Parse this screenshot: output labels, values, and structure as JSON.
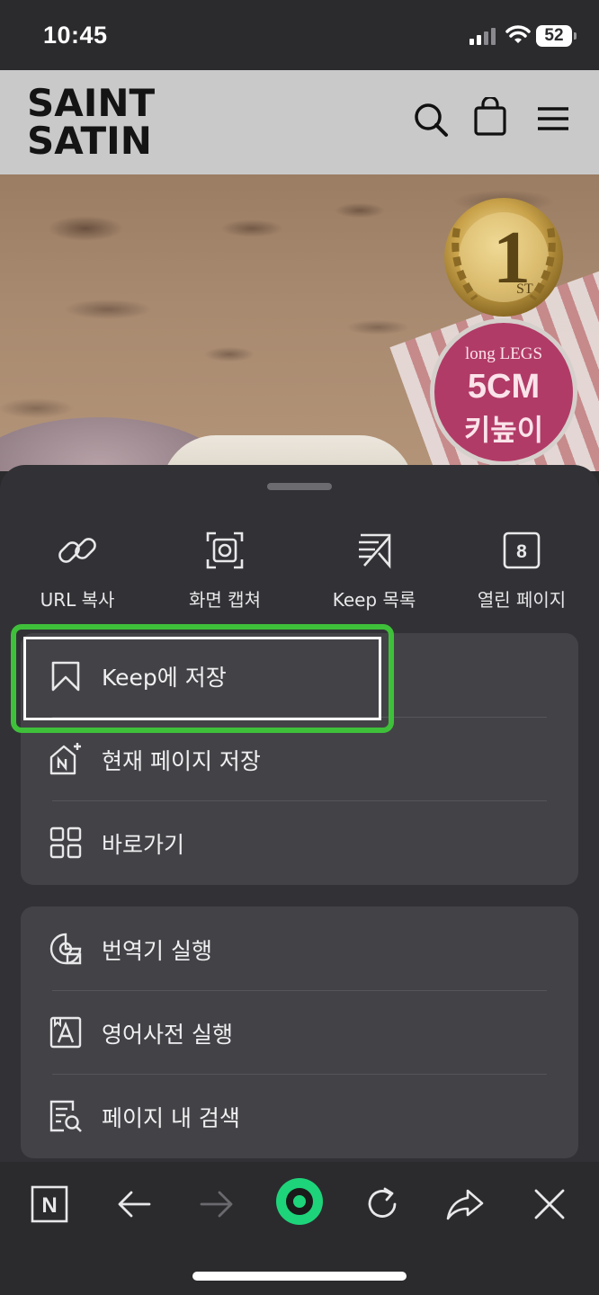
{
  "status_bar": {
    "time": "10:45",
    "battery": "52"
  },
  "site": {
    "logo_line1": "SAINT",
    "logo_line2": "SATIN",
    "icons": [
      "search-icon",
      "shopping-bag-icon",
      "menu-icon"
    ]
  },
  "hero": {
    "badge_rank": "1",
    "badge_rank_suffix": "ST",
    "badge_top": "long LEGS",
    "badge_main": "5CM",
    "badge_sub": "키높이"
  },
  "quick_actions": [
    {
      "label": "URL 복사",
      "icon": "link-icon"
    },
    {
      "label": "화면 캡쳐",
      "icon": "screen-capture-icon"
    },
    {
      "label": "Keep 목록",
      "icon": "keep-list-icon"
    },
    {
      "label": "열린 페이지",
      "icon": "open-pages-icon",
      "count": "8"
    }
  ],
  "menu_group1": [
    {
      "label": "Keep에 저장",
      "icon": "bookmark-icon"
    },
    {
      "label": "현재 페이지 저장",
      "icon": "save-page-icon"
    },
    {
      "label": "바로가기",
      "icon": "shortcut-grid-icon"
    }
  ],
  "menu_group2": [
    {
      "label": "번역기 실행",
      "icon": "translator-icon"
    },
    {
      "label": "영어사전 실행",
      "icon": "dictionary-icon"
    },
    {
      "label": "페이지 내 검색",
      "icon": "find-in-page-icon"
    }
  ],
  "toolbar": {
    "icons": [
      "naver-home-icon",
      "back-arrow-icon",
      "forward-arrow-icon",
      "green-dot-icon",
      "reload-icon",
      "share-icon",
      "close-icon"
    ],
    "naver_letter": "N",
    "accent_color": "#1ed47a"
  },
  "highlight_color": "#3fc03a"
}
